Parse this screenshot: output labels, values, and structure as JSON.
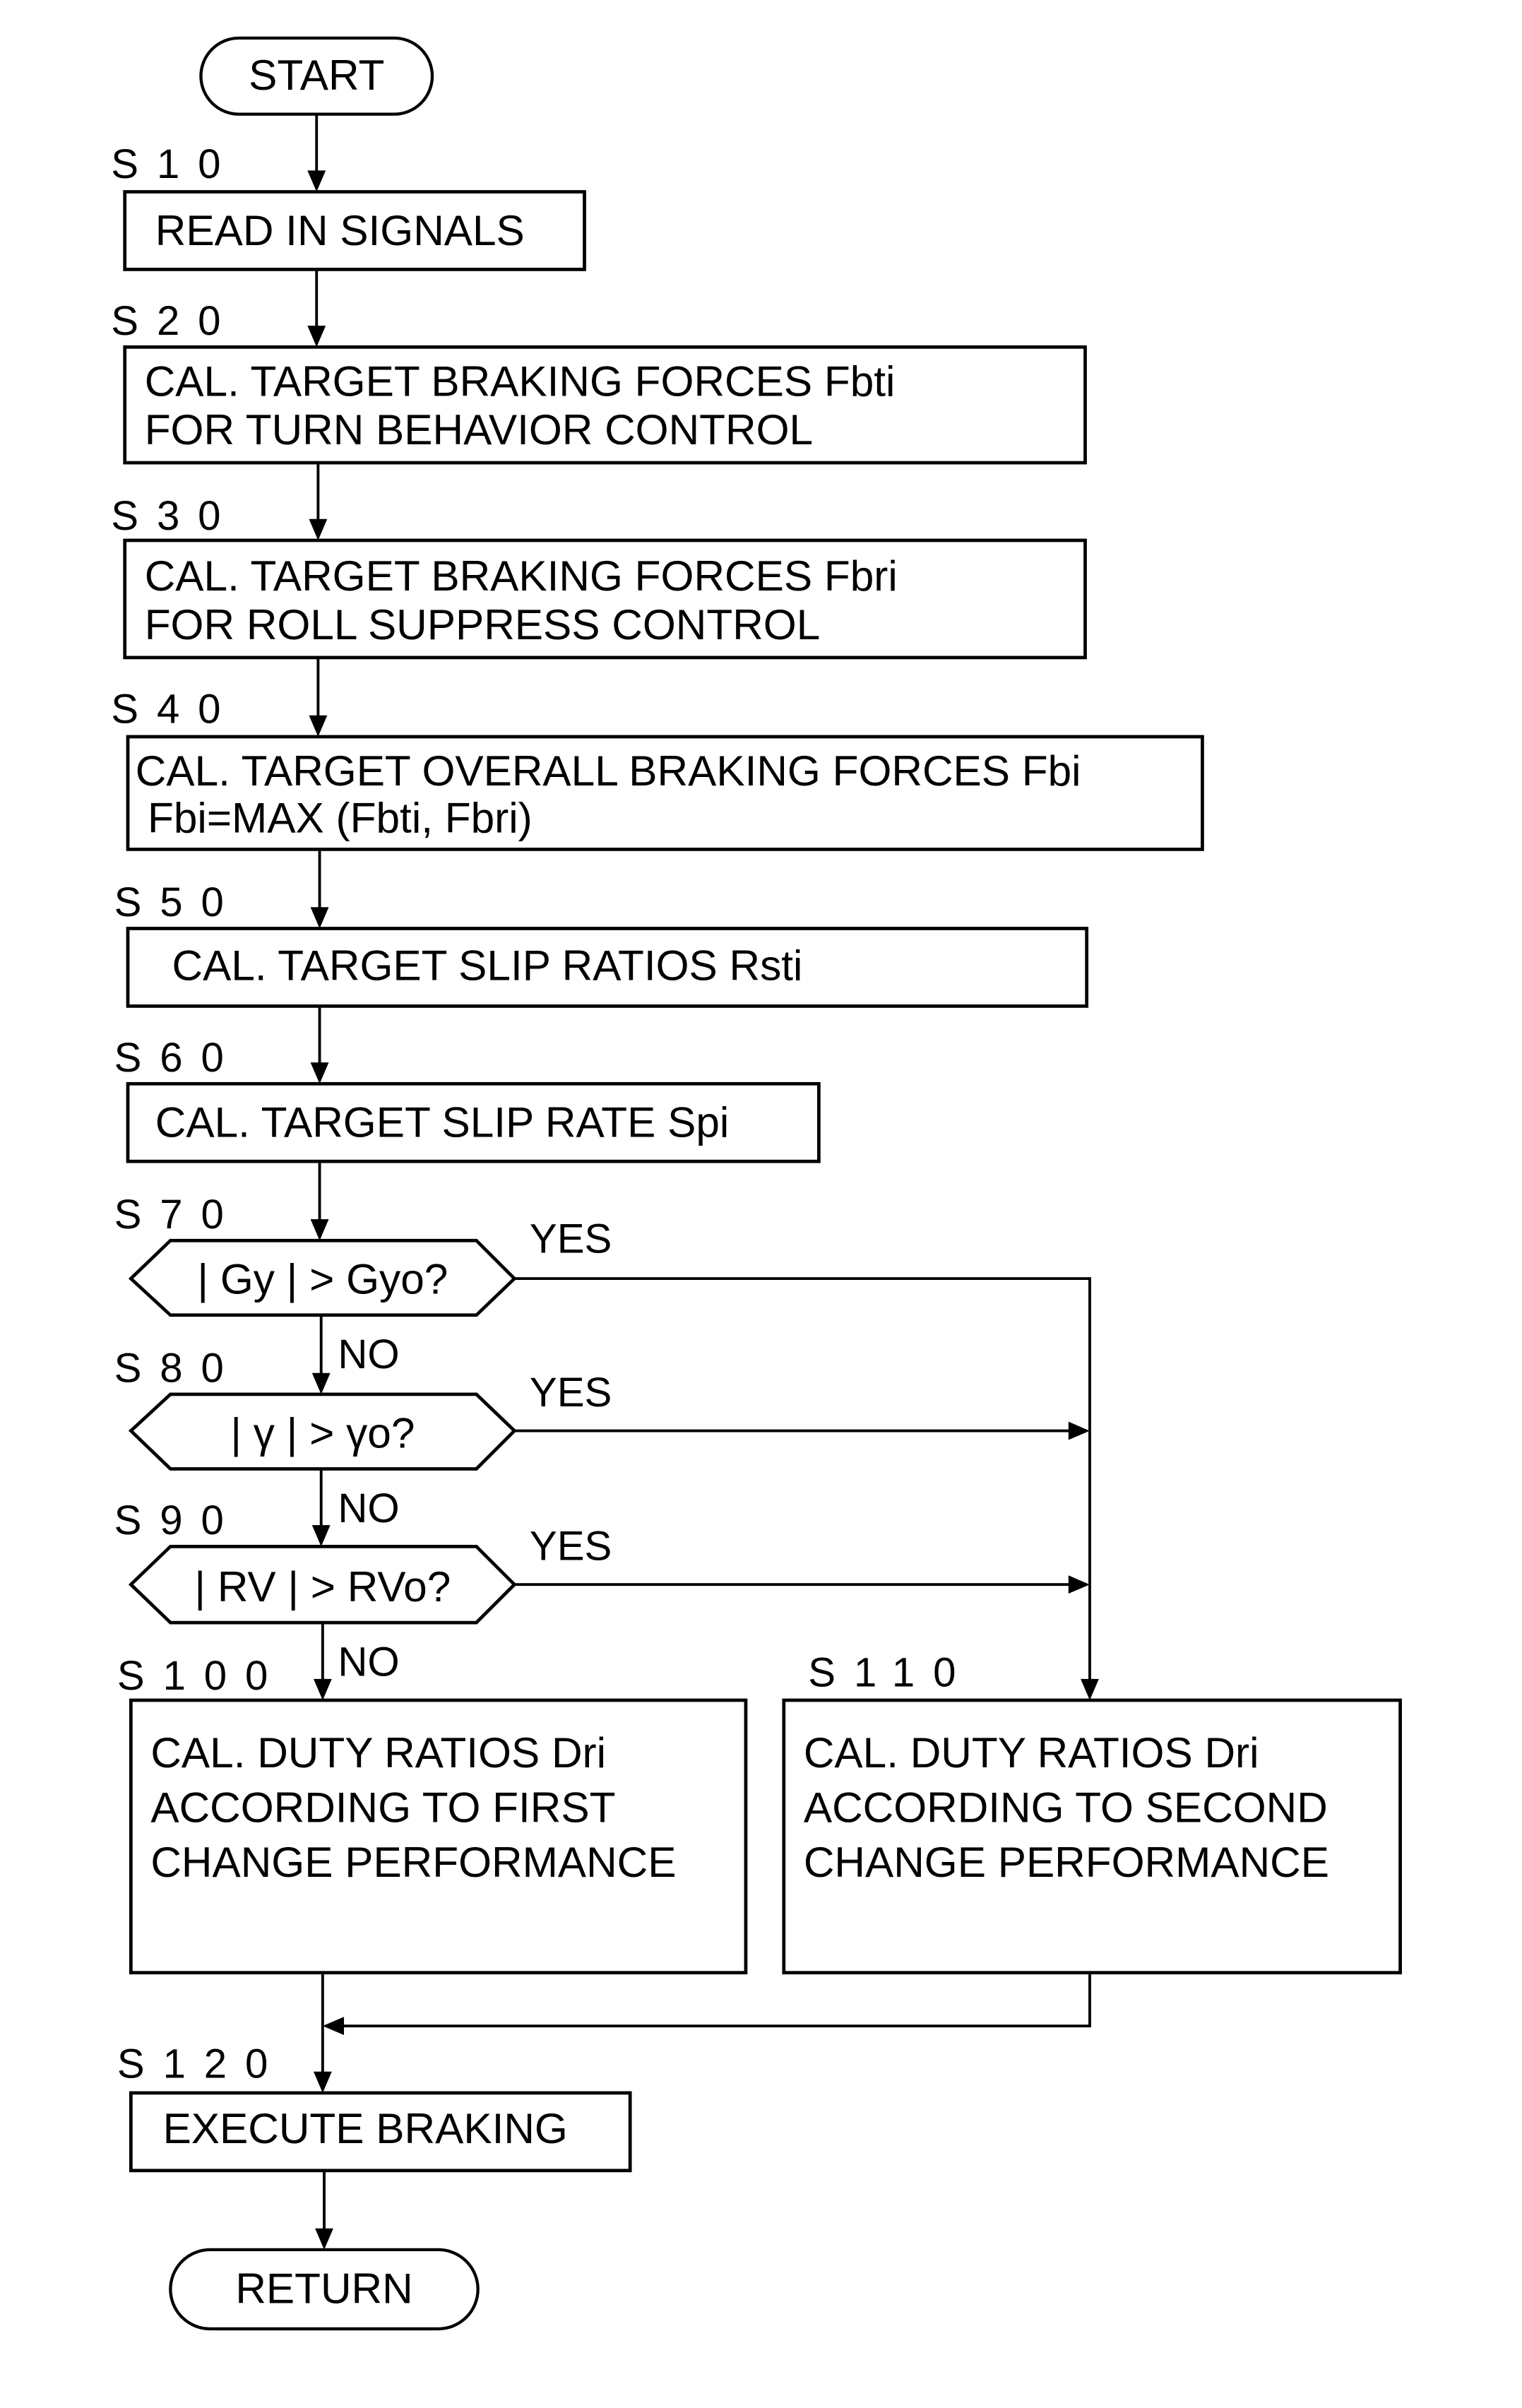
{
  "diagram": {
    "type": "flowchart",
    "colors": {
      "stroke": "#000000",
      "background": "#ffffff",
      "text": "#000000"
    },
    "start": {
      "label": "START"
    },
    "end": {
      "label": "RETURN"
    },
    "steps": [
      {
        "id": "S10",
        "step_label": "S10",
        "lines": [
          "READ IN SIGNALS"
        ]
      },
      {
        "id": "S20",
        "step_label": "S20",
        "lines": [
          "CAL. TARGET BRAKING FORCES Fbti",
          "FOR TURN BEHAVIOR CONTROL"
        ]
      },
      {
        "id": "S30",
        "step_label": "S30",
        "lines": [
          "CAL. TARGET BRAKING FORCES Fbri",
          "FOR ROLL SUPPRESS CONTROL"
        ]
      },
      {
        "id": "S40",
        "step_label": "S40",
        "lines": [
          "CAL. TARGET OVERALL BRAKING FORCES Fbi",
          "Fbi=MAX (Fbti, Fbri)"
        ]
      },
      {
        "id": "S50",
        "step_label": "S50",
        "lines": [
          "CAL. TARGET SLIP RATIOS Rsti"
        ]
      },
      {
        "id": "S60",
        "step_label": "S60",
        "lines": [
          "CAL. TARGET SLIP RATE Spi"
        ]
      }
    ],
    "decisions": [
      {
        "id": "S70",
        "step_label": "S70",
        "condition": "| Gy | > Gyo?",
        "yes_label": "YES",
        "no_label": "NO"
      },
      {
        "id": "S80",
        "step_label": "S80",
        "condition": "| γ | > γo?",
        "yes_label": "YES",
        "no_label": "NO"
      },
      {
        "id": "S90",
        "step_label": "S90",
        "condition": "| RV | > RVo?",
        "yes_label": "YES",
        "no_label": "NO"
      }
    ],
    "branches": {
      "S100": {
        "step_label": "S100",
        "lines": [
          "CAL. DUTY RATIOS Dri",
          "ACCORDING TO FIRST",
          "CHANGE PERFORMANCE"
        ]
      },
      "S110": {
        "step_label": "S110",
        "lines": [
          "CAL. DUTY RATIOS Dri",
          "ACCORDING TO SECOND",
          "CHANGE PERFORMANCE"
        ]
      }
    },
    "final_step": {
      "id": "S120",
      "step_label": "S120",
      "lines": [
        "EXECUTE BRAKING"
      ]
    }
  }
}
